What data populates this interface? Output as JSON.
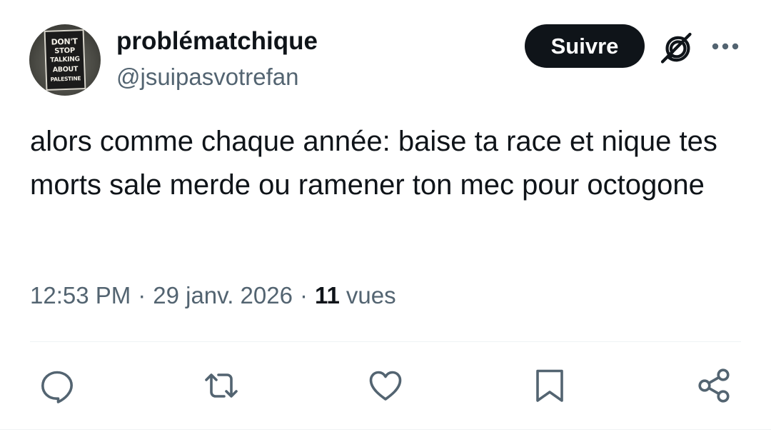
{
  "author": {
    "display_name": "problématchique",
    "handle": "@jsuipasvotrefan",
    "avatar_sign_lines": [
      "DON'T",
      "STOP",
      "TALKING",
      "ABOUT",
      "PALESTINE"
    ]
  },
  "header": {
    "follow_label": "Suivre",
    "grok_icon": "grok-icon",
    "more_icon": "more-icon"
  },
  "tweet": {
    "text": "alors comme chaque année: baise ta race et nique tes morts sale merde ou ramener ton mec pour octogone",
    "time": "12:53 PM",
    "separator": "·",
    "date": "29 janv. 2026",
    "views_count": "11",
    "views_label": "vues"
  },
  "actions": [
    {
      "name": "reply",
      "icon": "reply-icon"
    },
    {
      "name": "retweet",
      "icon": "retweet-icon"
    },
    {
      "name": "like",
      "icon": "heart-icon"
    },
    {
      "name": "bookmark",
      "icon": "bookmark-icon"
    },
    {
      "name": "share",
      "icon": "share-icon"
    }
  ],
  "colors": {
    "text_primary": "#0f1419",
    "text_secondary": "#536471",
    "icon": "#536471",
    "follow_bg": "#0f1419",
    "follow_text": "#ffffff",
    "divider": "#eff3f4"
  }
}
